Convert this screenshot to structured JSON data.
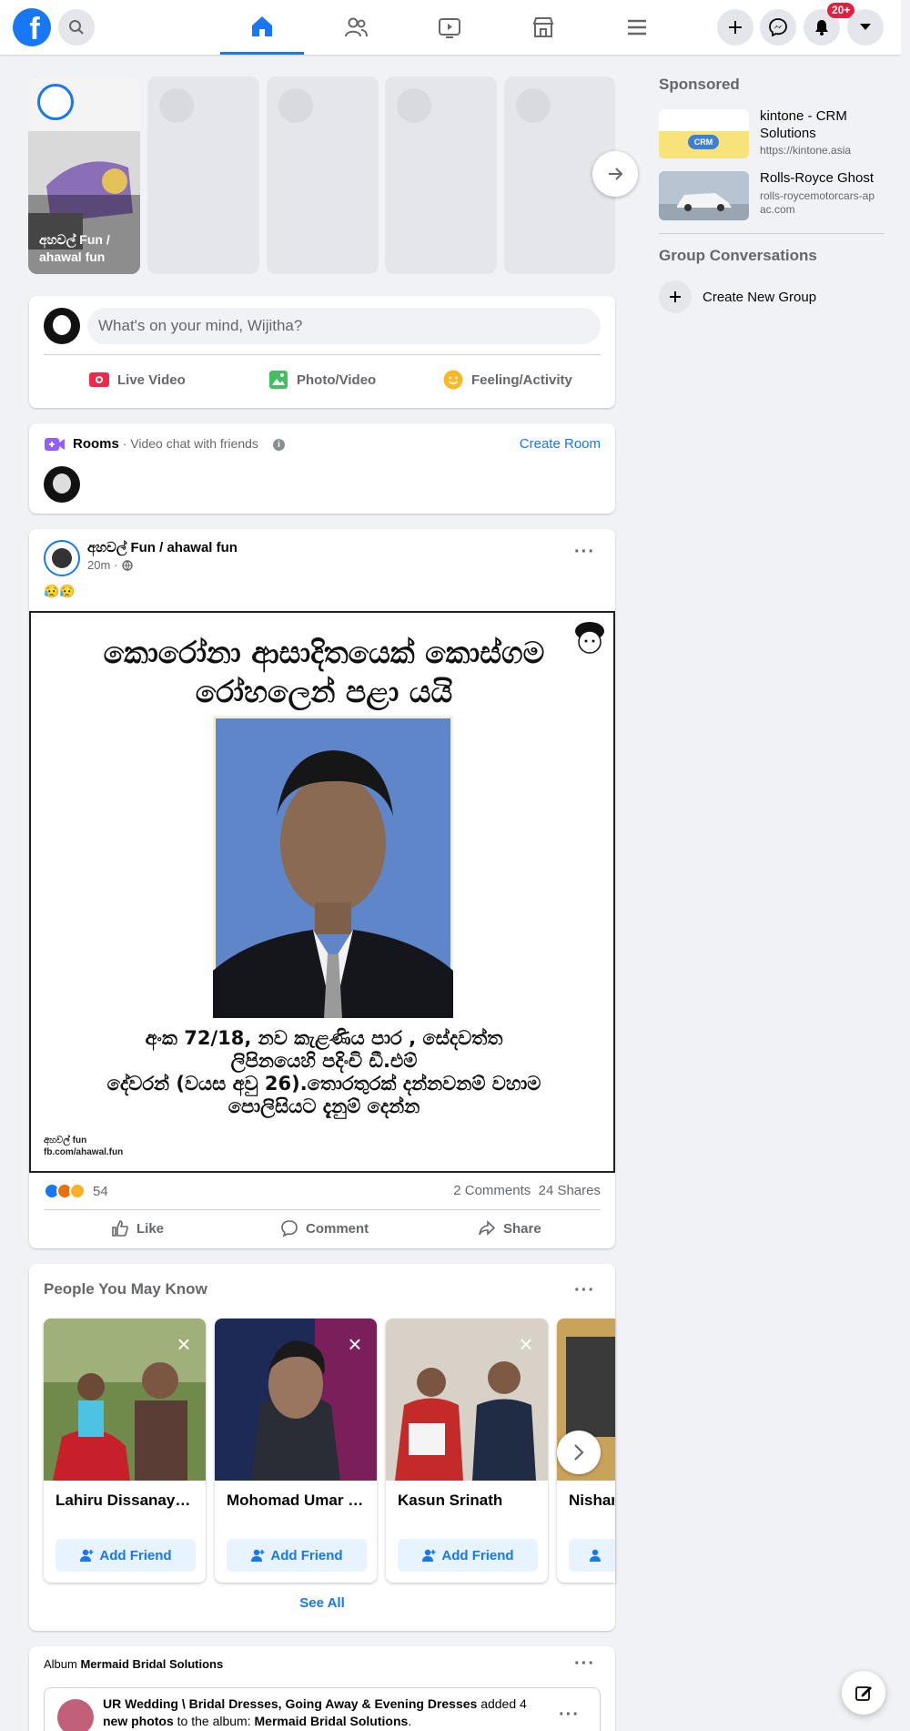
{
  "header": {
    "notifications_badge": "20+"
  },
  "stories": {
    "first": {
      "caption_line1": "අහවල් Fun /",
      "caption_line2": "ahawal fun"
    }
  },
  "composer": {
    "placeholder": "What's on your mind, Wijitha?",
    "live_video": "Live Video",
    "photo_video": "Photo/Video",
    "feeling": "Feeling/Activity"
  },
  "rooms": {
    "title": "Rooms",
    "subtitle": " · Video chat with friends",
    "create": "Create Room"
  },
  "post": {
    "page_name": "අහවල් Fun",
    "page_name_suffix": " / ahawal fun",
    "time": "20m",
    "emoji_text": "😥😥",
    "image": {
      "headline_line1": "කොරෝනා ආසාදිතයෙක් කොස්ගම",
      "headline_line2": "රෝහලෙන් පළා යයි",
      "body_line1": "අංක 72/18, නව කැළණිය පාර , සේදවත්ත",
      "body_line2": "ලිපිනයෙහි පදිංචි ඩී.එම්",
      "body_line3": "දේවරන් (වයස අවු 26).තොරතුරක් දන්නවනම් වහාම",
      "body_line4": "පොලිසියට දැනුම් දෙන්න",
      "watermark_line1": "අහවල් fun",
      "watermark_line2": "fb.com/ahawal.fun"
    },
    "reaction_count": "54",
    "comments": "2 Comments",
    "shares": "24 Shares",
    "like": "Like",
    "comment": "Comment",
    "share": "Share"
  },
  "pymk": {
    "title": "People You May Know",
    "see_all": "See All",
    "add_label": "Add Friend",
    "people": [
      {
        "name": "Lahiru Dissanayake"
      },
      {
        "name": "Mohomad Umar Khan"
      },
      {
        "name": "Kasun Srinath"
      },
      {
        "name": "Nishan"
      }
    ]
  },
  "album_post": {
    "prefix": "Album ",
    "album_name": "Mermaid Bridal Solutions",
    "author": "UR Wedding \\ Bridal Dresses, Going Away & Evening Dresses",
    "added": " added 4",
    "line2_start": "new photos",
    "line2_mid": " to the album: ",
    "line2_album": "Mermaid Bridal Solutions",
    "line2_end": "."
  },
  "sidebar": {
    "sponsored_title": "Sponsored",
    "ads": [
      {
        "title": "kintone - CRM Solutions",
        "url": "https://kintone.asia",
        "thumb_text": "CRM"
      },
      {
        "title": "Rolls-Royce Ghost",
        "url": "rolls-roycemotorcars-apac.com"
      }
    ],
    "group_conversations_title": "Group Conversations",
    "create_group": "Create New Group"
  },
  "colors": {
    "brand": "#1877f2",
    "background": "#f0f2f5",
    "badge": "#e41e3f",
    "secondary_text": "#65676b"
  }
}
